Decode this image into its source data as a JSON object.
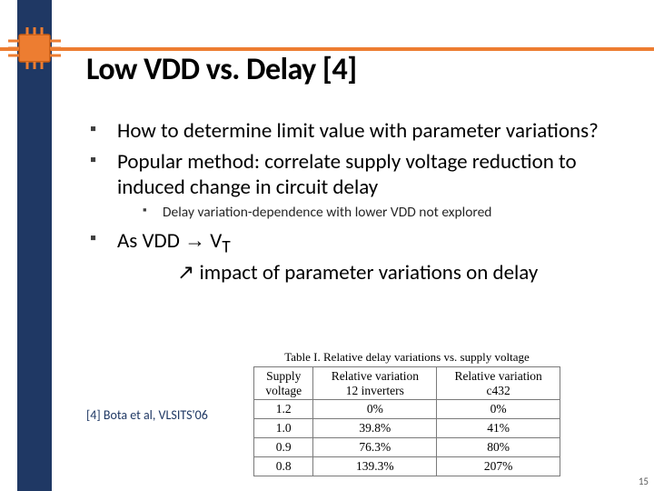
{
  "title": "Low VDD vs. Delay [4]",
  "bullets": {
    "b1": "How to determine limit value with parameter variations?",
    "b2": "Popular method:  correlate supply voltage reduction to induced change in circuit delay",
    "b2_sub": "Delay variation-dependence with lower VDD not explored",
    "b3_pre": "As VDD ",
    "b3_arrow": "→",
    "b3_post": " V",
    "b3_sub": "T",
    "b4_arrow": "↗",
    "b4_text": " impact of parameter variations on delay"
  },
  "citation": "[4] Bota et al, VLSITS'06",
  "page_number": "15",
  "table": {
    "title": "Table I. Relative delay variations vs. supply voltage",
    "headers": {
      "h1a": "Supply",
      "h1b": "voltage",
      "h2a": "Relative variation",
      "h2b": "12 inverters",
      "h3a": "Relative variation",
      "h3b": "c432"
    }
  },
  "chart_data": {
    "type": "table",
    "title": "Table I. Relative delay variations vs. supply voltage",
    "columns": [
      "Supply voltage",
      "Relative variation 12 inverters",
      "Relative variation c432"
    ],
    "rows": [
      {
        "supply_voltage": "1.2",
        "inverters": "0%",
        "c432": "0%"
      },
      {
        "supply_voltage": "1.0",
        "inverters": "39.8%",
        "c432": "41%"
      },
      {
        "supply_voltage": "0.9",
        "inverters": "76.3%",
        "c432": "80%"
      },
      {
        "supply_voltage": "0.8",
        "inverters": "139.3%",
        "c432": "207%"
      }
    ]
  }
}
